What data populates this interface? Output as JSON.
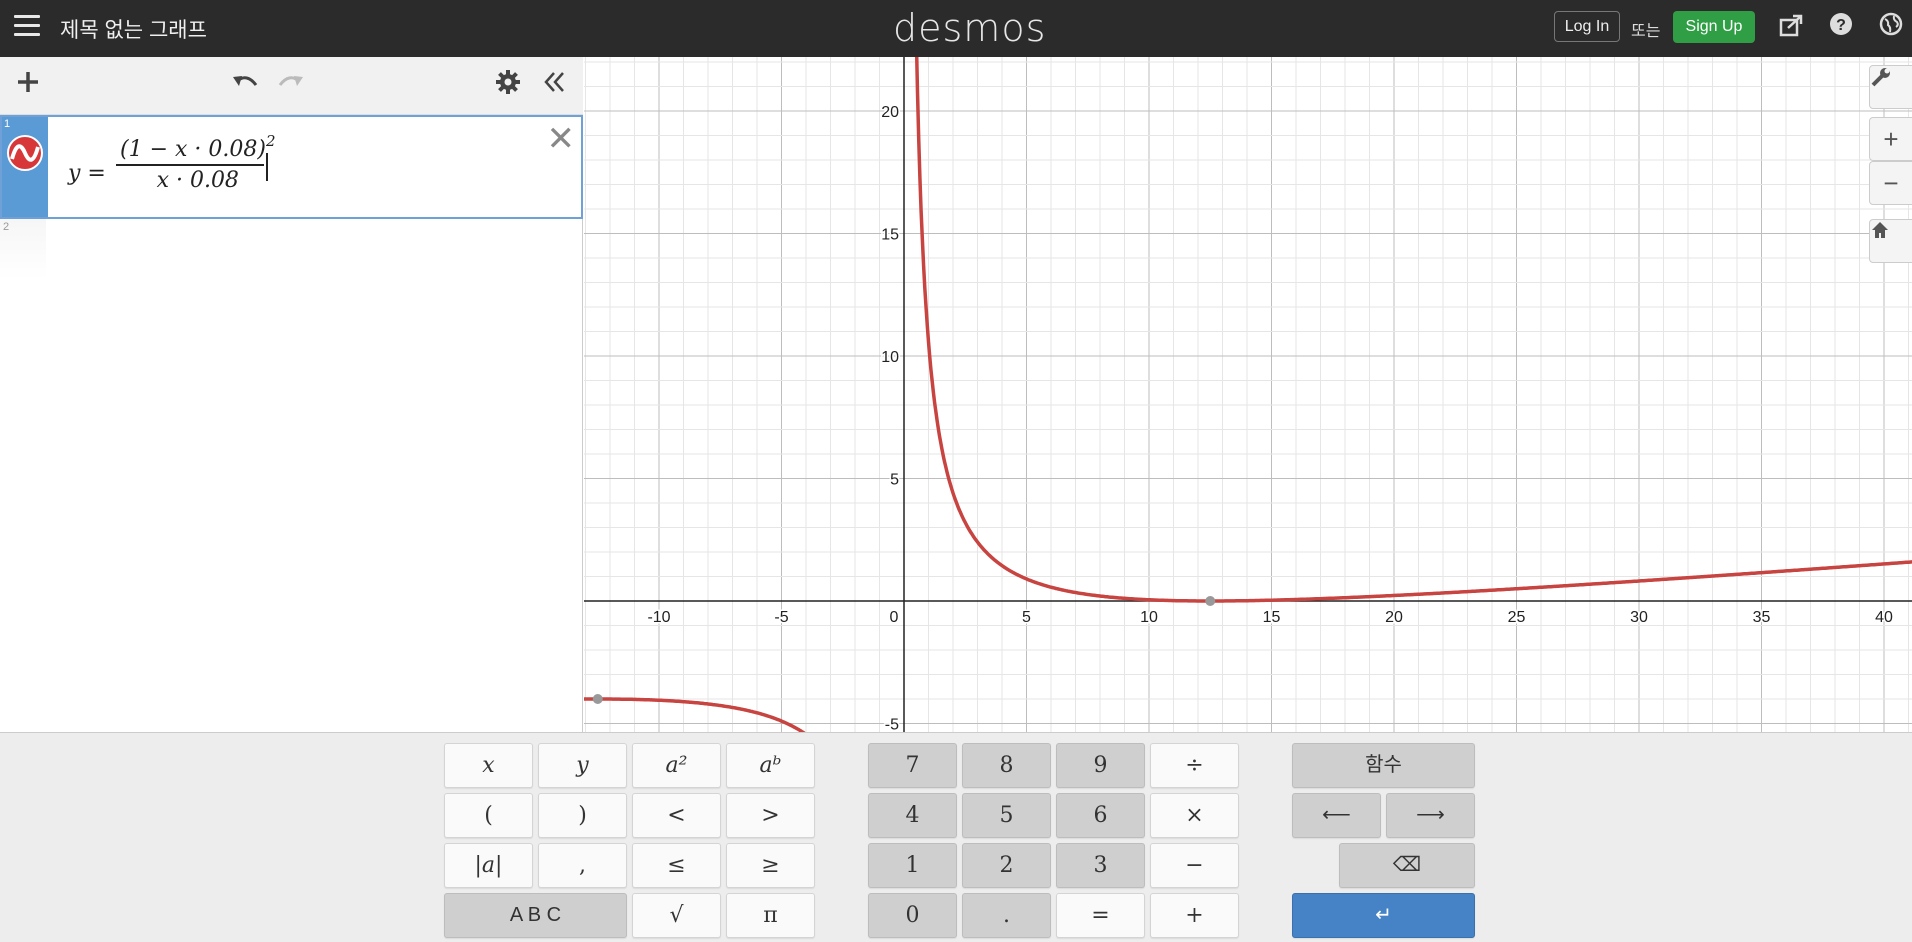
{
  "header": {
    "title": "제목 없는 그래프",
    "logo": "desmos",
    "login_label": "Log In",
    "or_text": "또는",
    "signup_label": "Sign Up",
    "icons": [
      "share-icon",
      "help-icon",
      "language-globe-icon"
    ]
  },
  "expressions": {
    "toolbar_icons": [
      "add-icon",
      "undo-icon",
      "redo-icon",
      "settings-icon",
      "collapse-icon"
    ],
    "items": [
      {
        "index": "1",
        "lhs": "y =",
        "numerator": "(1 − x · 0.08)",
        "exponent": "2",
        "denominator": "x · 0.08",
        "color": "#c74440"
      },
      {
        "index": "2"
      }
    ]
  },
  "graph": {
    "x_ticks": [
      "-10",
      "-5",
      "0",
      "5",
      "10",
      "15",
      "20",
      "25",
      "30",
      "35",
      "40"
    ],
    "y_ticks": [
      "20",
      "15",
      "10",
      "5",
      "-5"
    ],
    "curve_color": "#c74440",
    "side_buttons": [
      "wrench-icon",
      "zoom-in-icon",
      "zoom-out-icon",
      "home-icon"
    ]
  },
  "keypad": {
    "left": [
      "x",
      "y",
      "a²",
      "aᵇ",
      "(",
      ")",
      "<",
      ">",
      "|a|",
      ",",
      "≤",
      "≥",
      "A B C",
      "√",
      "π"
    ],
    "numbers": [
      "7",
      "8",
      "9",
      "÷",
      "4",
      "5",
      "6",
      "×",
      "1",
      "2",
      "3",
      "−",
      "0",
      ".",
      "=",
      "+"
    ],
    "functions_label": "함수",
    "left_arrow": "⟵",
    "right_arrow": "⟶",
    "backspace": "⌫",
    "enter": "↵"
  }
}
